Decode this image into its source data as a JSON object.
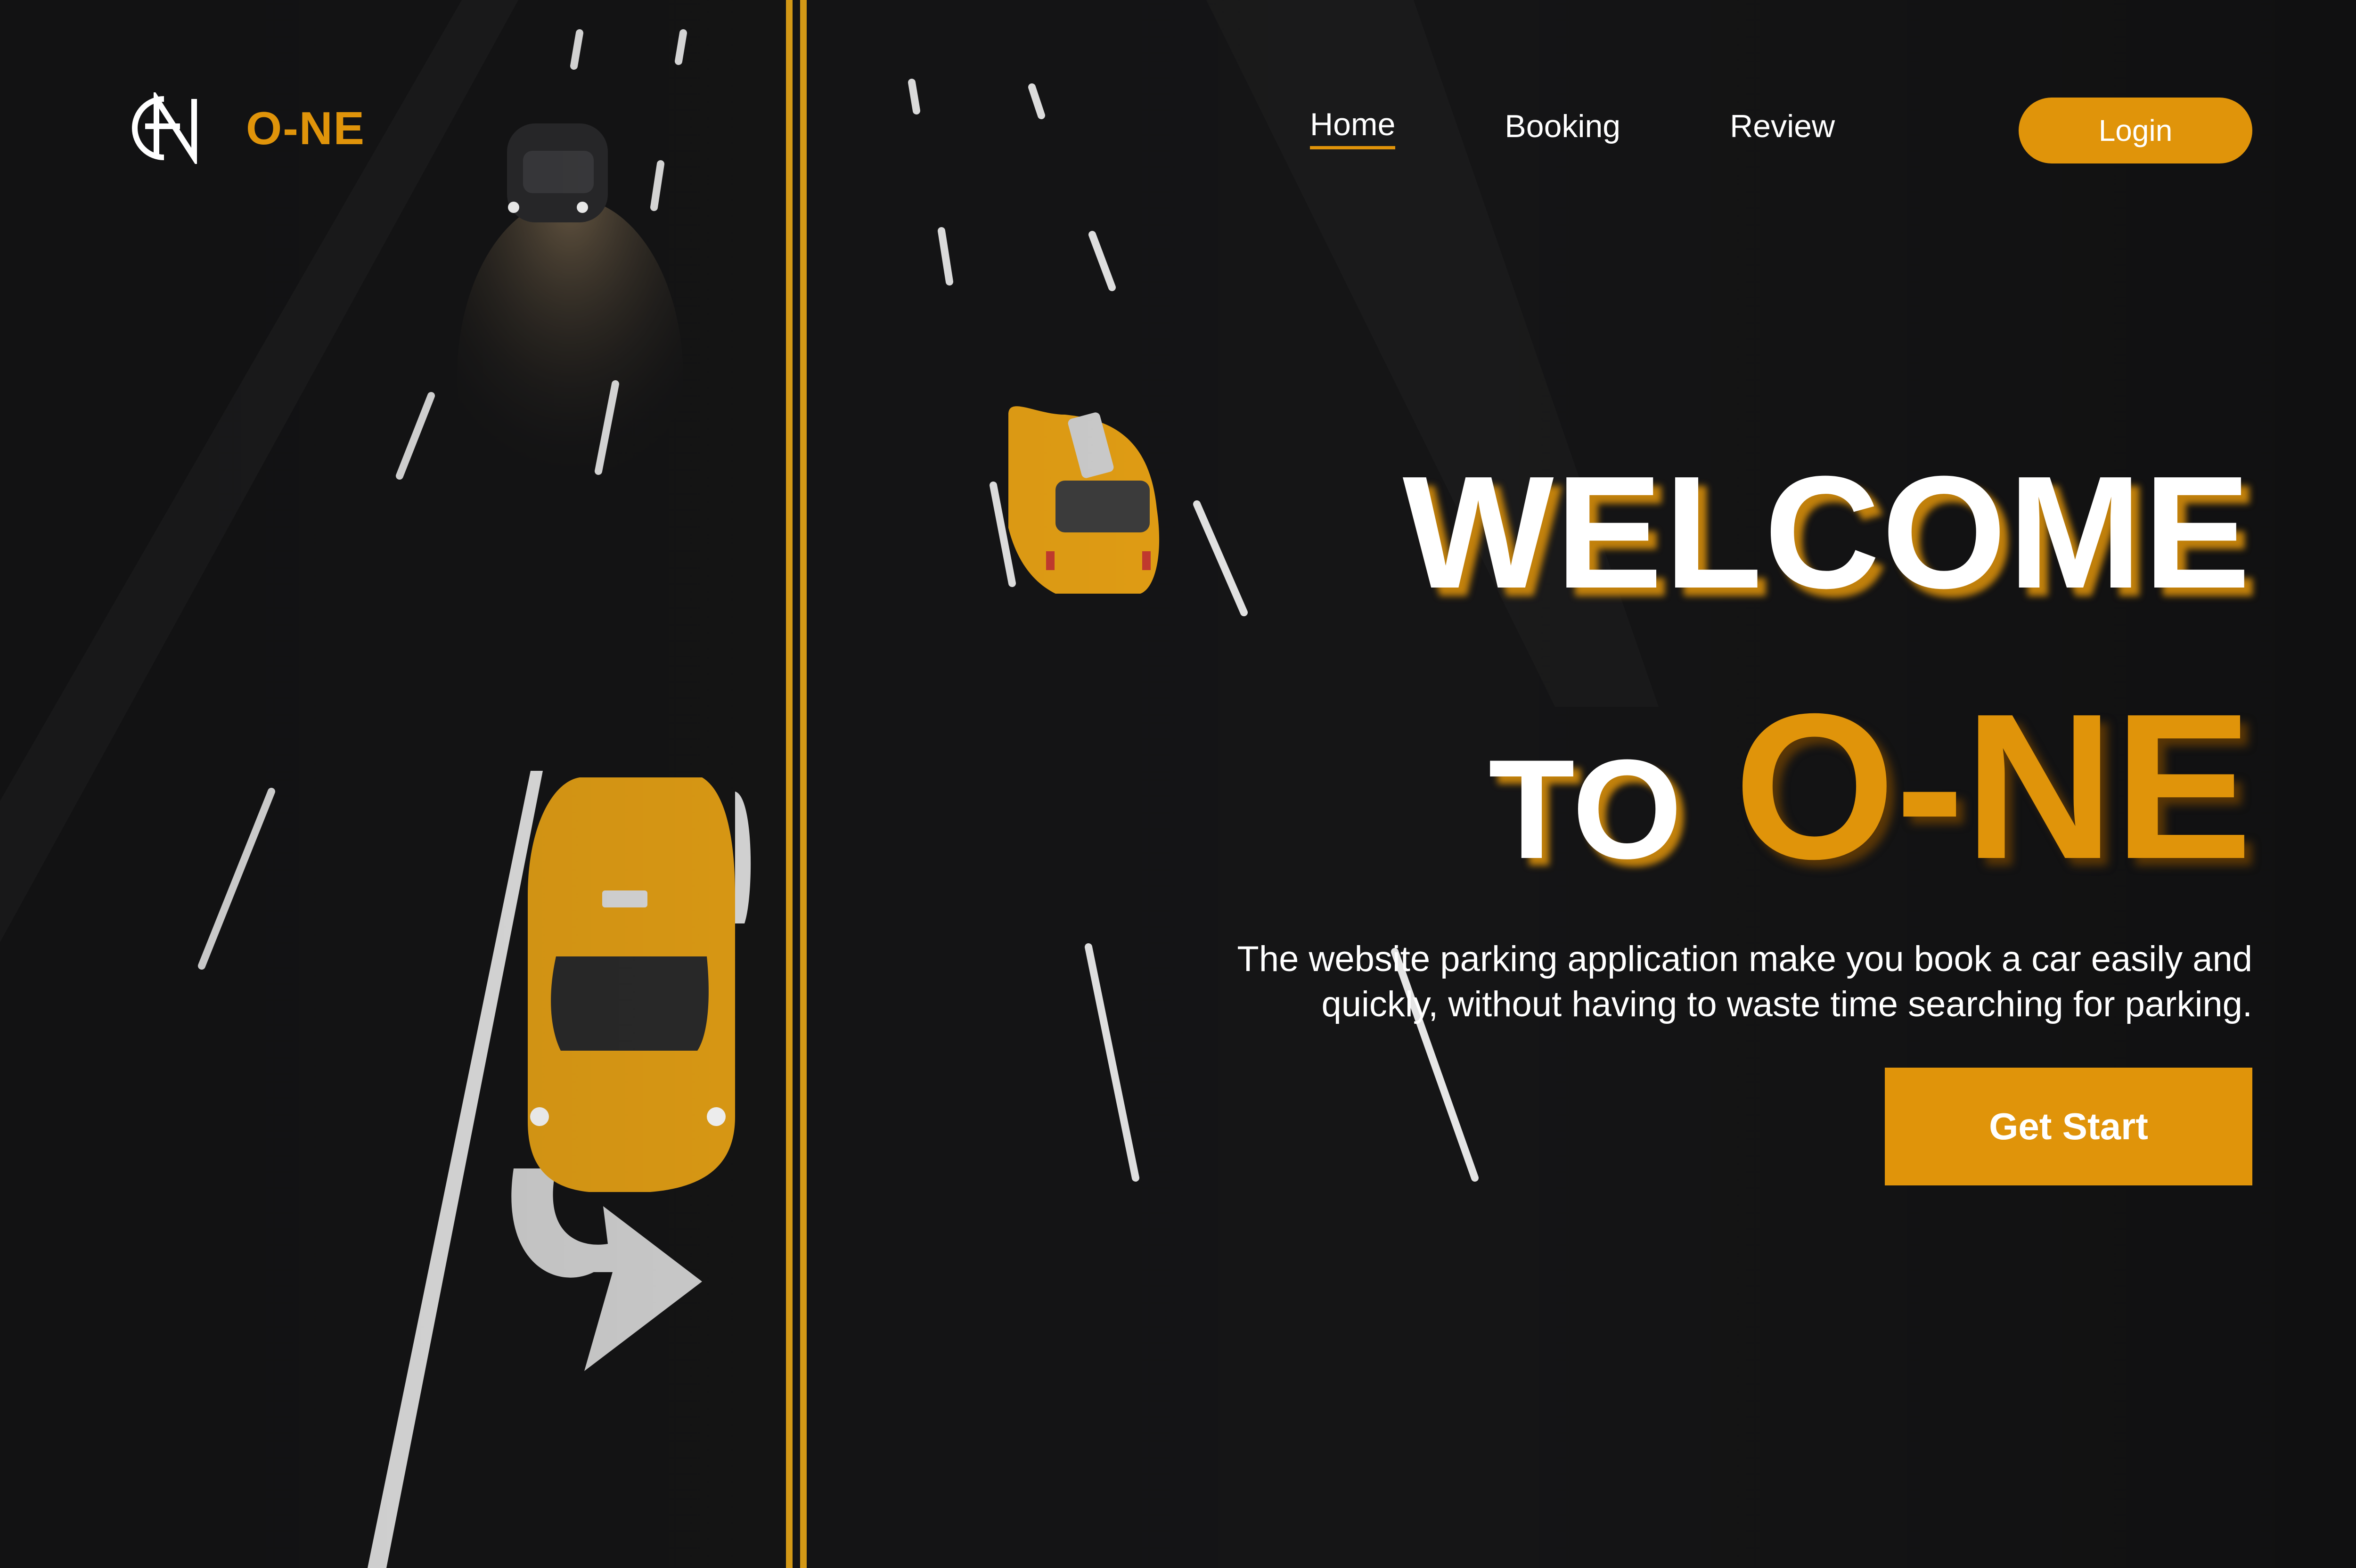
{
  "brand": {
    "name": "O-NE",
    "logo_icon": "monogram-logo-icon"
  },
  "nav": {
    "items": [
      {
        "label": "Home",
        "active": true
      },
      {
        "label": "Booking",
        "active": false
      },
      {
        "label": "Review",
        "active": false
      }
    ],
    "login_label": "Login"
  },
  "hero": {
    "line1": "WELCOME",
    "line2_prefix": "TO",
    "line2_brand": "O-NE",
    "description": "The website parking application make you book a car easily and quickly, without having to waste time searching for parking.",
    "cta_label": "Get Start"
  },
  "colors": {
    "accent": "#e0940a",
    "background": "#141414",
    "text": "#ffffff"
  }
}
